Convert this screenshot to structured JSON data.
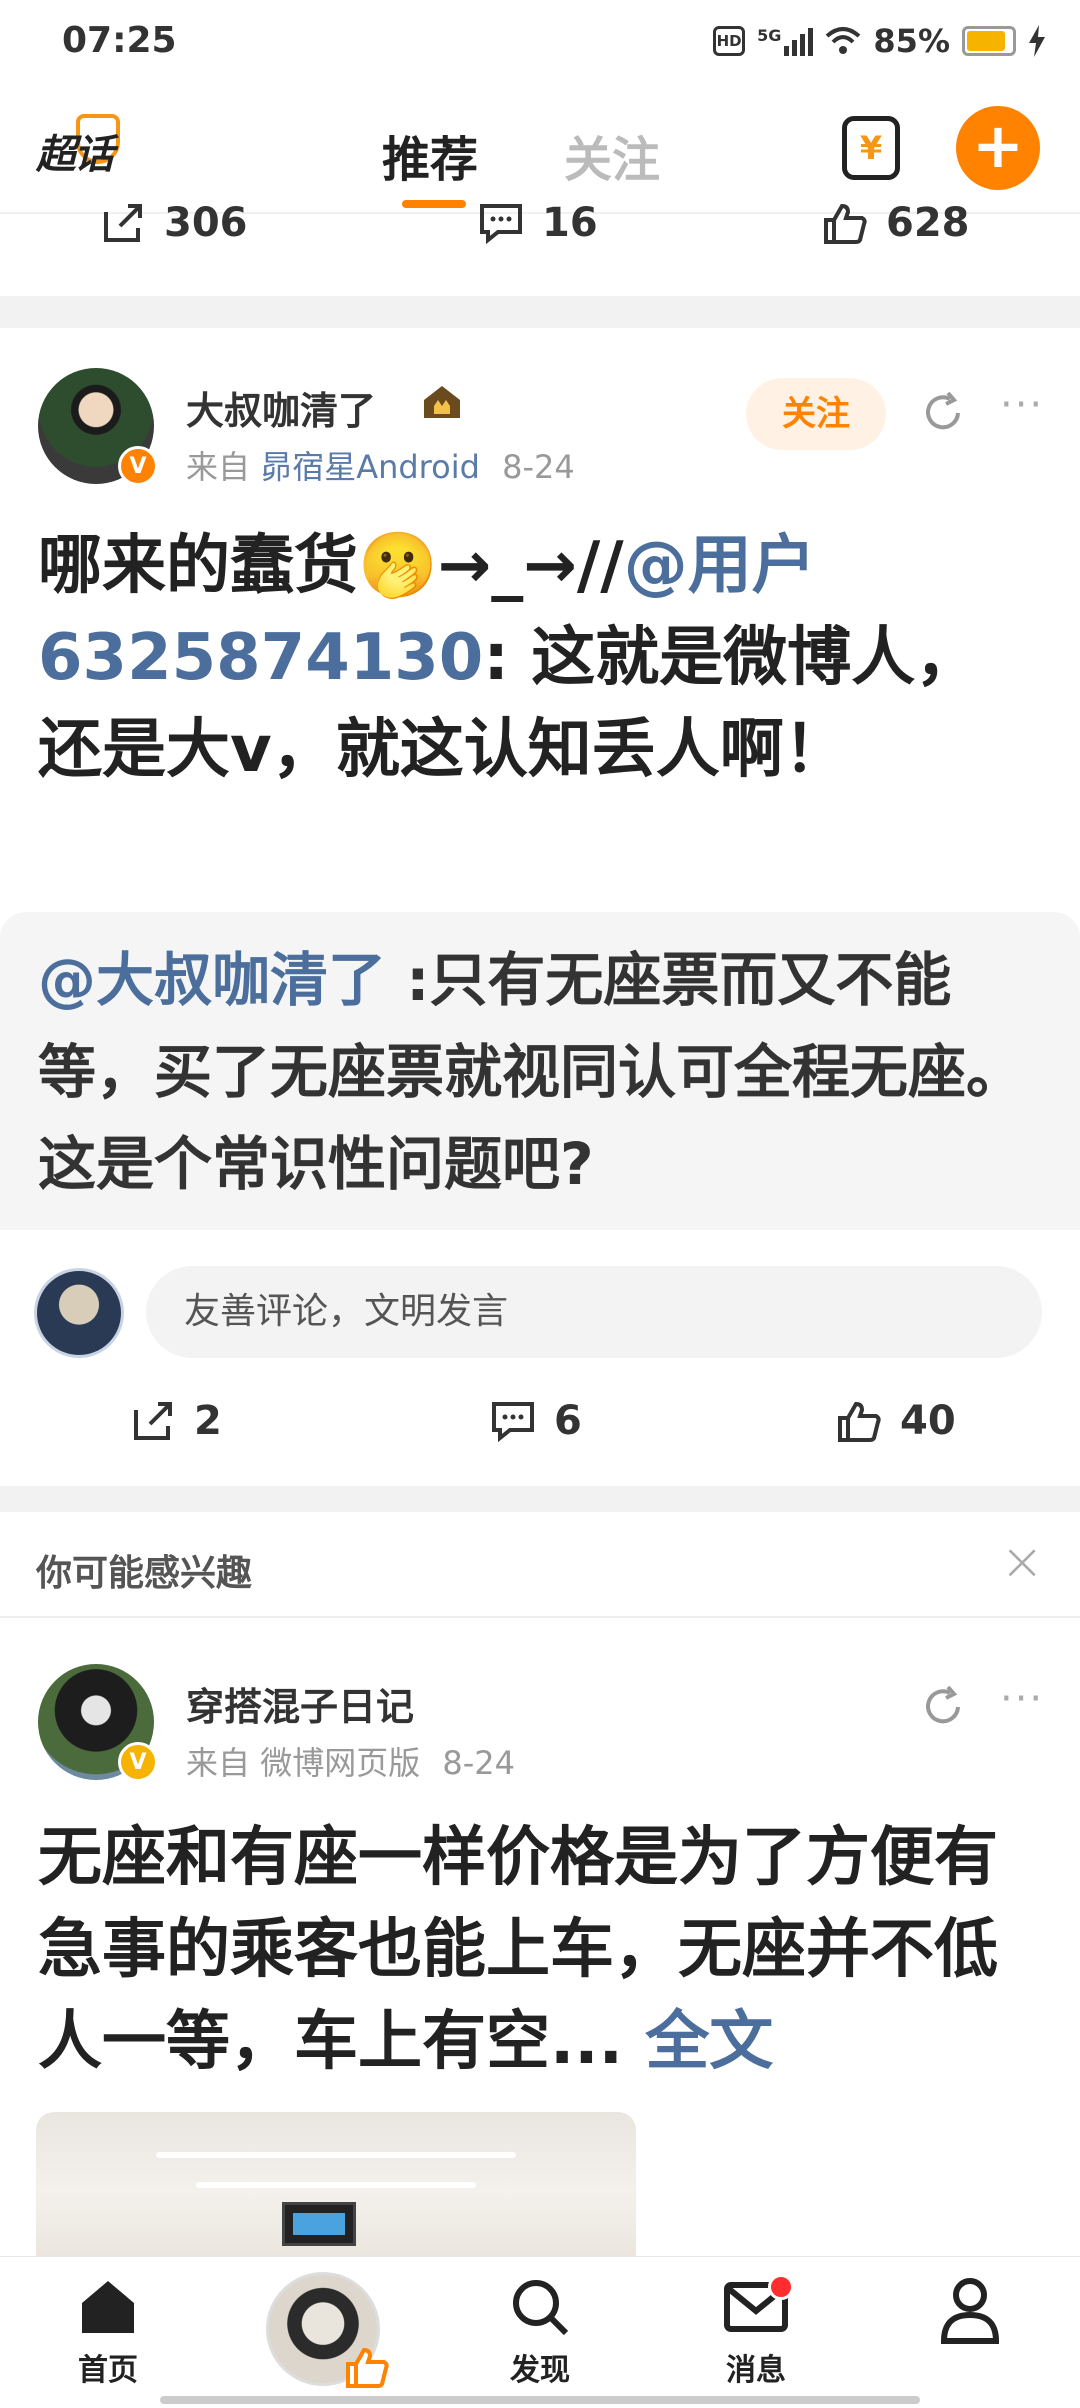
{
  "status_bar": {
    "time": "07:25",
    "network": "5G",
    "battery": "85%",
    "hd": "HD"
  },
  "top_nav": {
    "logo_text": "超话",
    "tab_recommend": "推荐",
    "tab_follow": "关注",
    "wallet_symbol": "¥",
    "plus_symbol": "+"
  },
  "prev_post_actions": {
    "share": "306",
    "comment": "16",
    "like": "628"
  },
  "post1": {
    "username": "大叔咖清了",
    "meta_from": "来自",
    "source": "昴宿星Android",
    "date": "8-24",
    "follow_label": "关注",
    "text_a": "哪来的蠢货🫢→_→//",
    "mention": "@用户6325874130",
    "text_b": ": 这就是微博人，还是大v，就这认知丢人啊！",
    "quote_mention": "@大叔咖清了",
    "quote_text": " :只有无座票而又不能等，买了无座票就视同认可全程无座。这是个常识性问题吧?",
    "comment_placeholder": "友善评论，文明发言",
    "actions": {
      "share": "2",
      "comment": "6",
      "like": "40"
    }
  },
  "interest": {
    "label": "你可能感兴趣",
    "close": "×"
  },
  "post2": {
    "username": "穿搭混子日记",
    "meta_from": "来自",
    "source": "微博网页版",
    "date": "8-24",
    "text": "无座和有座一样价格是为了方便有急事的乘客也能上车，无座并不低人一等，车上有空... ",
    "fulltext": "全文"
  },
  "tabbar": {
    "home": "首页",
    "discover": "发现",
    "messages": "消息"
  },
  "colors": {
    "accent": "#ff8200",
    "link": "#4b6e9c"
  }
}
